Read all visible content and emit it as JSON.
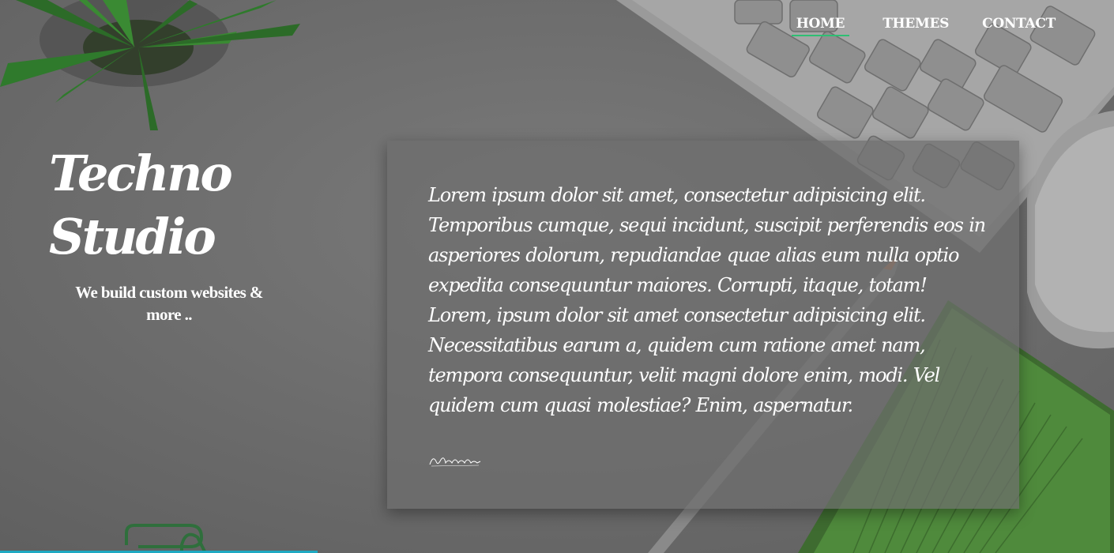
{
  "nav": {
    "items": [
      {
        "label": "HOME",
        "active": true
      },
      {
        "label": "THEMES",
        "active": false
      },
      {
        "label": "CONTACT",
        "active": false
      }
    ],
    "active_color": "#2ebf73"
  },
  "brand": {
    "title": "Techno Studio",
    "tagline": "We build custom websites & more .."
  },
  "card": {
    "paragraph_1": "Lorem ipsum dolor sit amet, consectetur adipisicing elit. Temporibus cumque, sequi incidunt, suscipit perferendis eos in asperiores dolorum, repudiandae quae alias eum nulla optio expedita consequuntur maiores. Corrupti, itaque, totam!",
    "paragraph_2": "Lorem, ipsum dolor sit amet consectetur adipisicing elit. Necessitatibus earum a, quidem cum ratione amet nam, tempora consequuntur, velit magni dolore enim, modi. Vel quidem cum quasi molestiae? Enim, aspernatur.",
    "signature_icon": "handwritten-signature"
  },
  "colors": {
    "accent_bar": "#1fa9c2",
    "plant_green": "#2f7a2c",
    "notebook_green": "#4f8a3c"
  }
}
